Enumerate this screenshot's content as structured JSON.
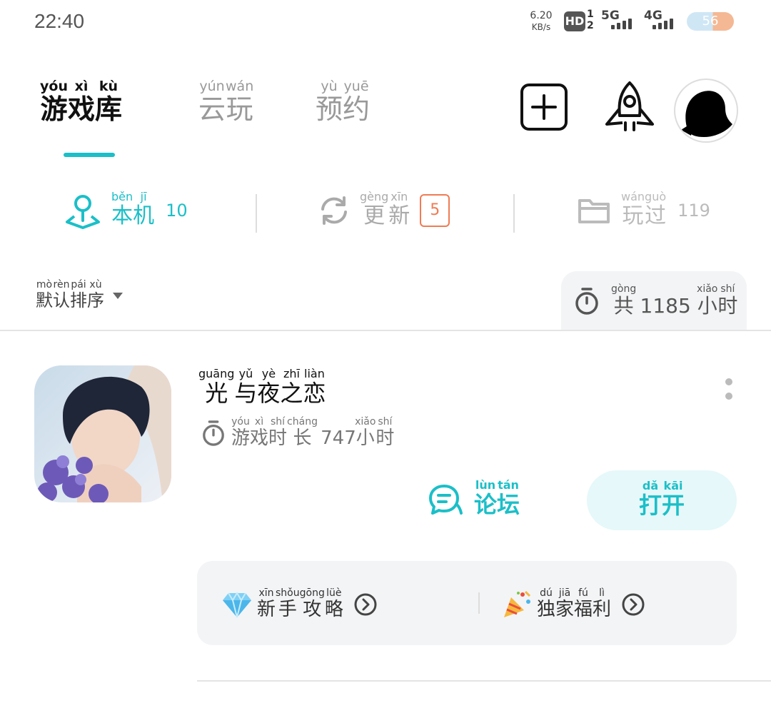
{
  "status_bar": {
    "time": "22:40",
    "net_speed_value": "6.20",
    "net_speed_unit": "KB/s",
    "hd_label": "HD",
    "hd_sim": "1\n2",
    "net_5g": "5G",
    "net_4g": "4G",
    "battery": "56"
  },
  "tabs": [
    {
      "label": "游戏库",
      "pinyin": [
        "yóu",
        "xì",
        "kù"
      ],
      "active": true
    },
    {
      "label": "云玩",
      "pinyin": [
        "yún",
        "wán"
      ],
      "active": false
    },
    {
      "label": "预约",
      "pinyin": [
        "yù",
        "yuē"
      ],
      "active": false
    }
  ],
  "filters": {
    "local": {
      "label": [
        "本",
        "机"
      ],
      "pinyin": [
        "běn",
        "jī"
      ],
      "count": "10"
    },
    "update": {
      "label": [
        "更",
        "新"
      ],
      "pinyin": [
        "gèng",
        "xīn"
      ],
      "badge": "5"
    },
    "played": {
      "label": [
        "玩",
        "过"
      ],
      "pinyin": [
        "wán",
        "guò"
      ],
      "count": "119"
    }
  },
  "sort": {
    "label": [
      "默",
      "认",
      "排",
      "序"
    ],
    "pinyin": [
      "mò",
      "rèn",
      "pái",
      "xù"
    ]
  },
  "total": {
    "prefix": "共",
    "prefix_pinyin": "gòng",
    "value": "1185",
    "unit": [
      "小",
      "时"
    ],
    "unit_pinyin": [
      "xiǎo",
      "shí"
    ]
  },
  "game": {
    "name": [
      "光",
      "与",
      "夜",
      "之",
      "恋"
    ],
    "name_pinyin": [
      "guāng",
      "yǔ",
      "yè",
      "zhī",
      "liàn"
    ],
    "playtime_label": [
      "游",
      "戏",
      "时",
      "长"
    ],
    "playtime_pinyin": [
      "yóu",
      "xì",
      "shí",
      "cháng"
    ],
    "playtime_value": "747",
    "playtime_unit": [
      "小",
      "时"
    ],
    "playtime_unit_pinyin": [
      "xiǎo",
      "shí"
    ],
    "forum_label": [
      "论",
      "坛"
    ],
    "forum_pinyin": [
      "lùn",
      "tán"
    ],
    "open_label": [
      "打",
      "开"
    ],
    "open_pinyin": [
      "dǎ",
      "kāi"
    ],
    "guide_label": [
      "新",
      "手",
      "攻",
      "略"
    ],
    "guide_pinyin": [
      "xīn",
      "shǒu",
      "gōng",
      "lüè"
    ],
    "welfare_label": [
      "独",
      "家",
      "福",
      "利"
    ],
    "welfare_pinyin": [
      "dú",
      "jiā",
      "fú",
      "lì"
    ]
  },
  "colors": {
    "accent": "#1bbfc8",
    "badge": "#f07b54",
    "muted": "#999999"
  },
  "icons": [
    "add-icon",
    "rocket-icon",
    "location-icon",
    "refresh-icon",
    "folder-icon",
    "sort-caret-icon",
    "stopwatch-icon",
    "more-icon",
    "forum-chat-icon",
    "diamond-icon",
    "party-popper-icon",
    "arrow-right-circle-icon"
  ]
}
